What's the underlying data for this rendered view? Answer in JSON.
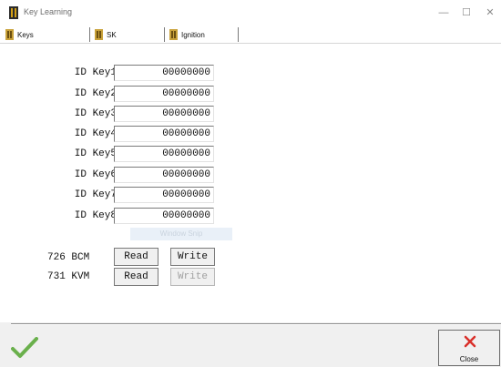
{
  "window": {
    "title": "Key Learning",
    "minimize": "—",
    "maximize": "☐",
    "close": "✕"
  },
  "tabs": [
    {
      "label": "Keys"
    },
    {
      "label": "SK"
    },
    {
      "label": "Ignition"
    }
  ],
  "keys": [
    {
      "label": "ID Key1",
      "value": "00000000"
    },
    {
      "label": "ID Key2",
      "value": "00000000"
    },
    {
      "label": "ID Key3",
      "value": "00000000"
    },
    {
      "label": "ID Key4",
      "value": "00000000"
    },
    {
      "label": "ID Key5",
      "value": "00000000"
    },
    {
      "label": "ID Key6",
      "value": "00000000"
    },
    {
      "label": "ID Key7",
      "value": "00000000"
    },
    {
      "label": "ID Key8",
      "value": "00000000"
    }
  ],
  "watermark": "Window Snip",
  "modules": [
    {
      "label": "726 BCM",
      "read": "Read",
      "write": "Write",
      "write_enabled": true
    },
    {
      "label": "731 KVM",
      "read": "Read",
      "write": "Write",
      "write_enabled": false
    }
  ],
  "footer": {
    "close_label": "Close",
    "ok_icon": "checkmark-icon",
    "close_icon": "x-icon",
    "accent_ok": "#6ab04c",
    "accent_close": "#d9302a"
  }
}
